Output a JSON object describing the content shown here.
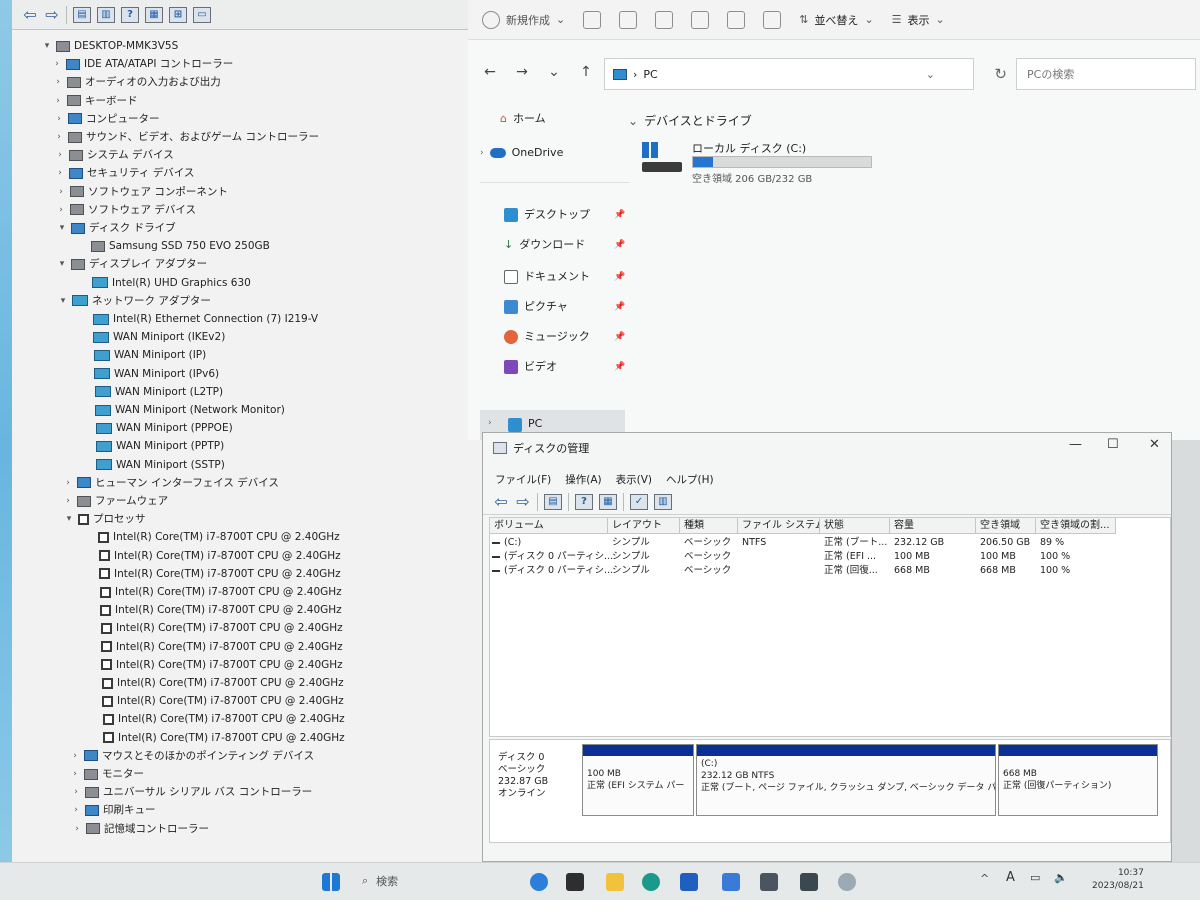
{
  "device_manager": {
    "root": "DESKTOP-MMK3V5S",
    "categories": [
      {
        "label": "IDE ATA/ATAPI コントローラー",
        "expanded": false
      },
      {
        "label": "オーディオの入力および出力",
        "expanded": false
      },
      {
        "label": "キーボード",
        "expanded": false
      },
      {
        "label": "コンピューター",
        "expanded": false
      },
      {
        "label": "サウンド、ビデオ、およびゲーム コントローラー",
        "expanded": false
      },
      {
        "label": "システム デバイス",
        "expanded": false
      },
      {
        "label": "セキュリティ デバイス",
        "expanded": false
      },
      {
        "label": "ソフトウェア コンポーネント",
        "expanded": false
      },
      {
        "label": "ソフトウェア デバイス",
        "expanded": false
      },
      {
        "label": "ディスク ドライブ",
        "expanded": true
      },
      {
        "label": "ディスプレイ アダプター",
        "expanded": true
      },
      {
        "label": "ネットワーク アダプター",
        "expanded": true
      },
      {
        "label": "ヒューマン インターフェイス デバイス",
        "expanded": false
      },
      {
        "label": "ファームウェア",
        "expanded": false
      },
      {
        "label": "プロセッサ",
        "expanded": true
      },
      {
        "label": "マウスとそのほかのポインティング デバイス",
        "expanded": false
      },
      {
        "label": "モニター",
        "expanded": false
      },
      {
        "label": "ユニバーサル シリアル バス コントローラー",
        "expanded": false
      },
      {
        "label": "印刷キュー",
        "expanded": false
      },
      {
        "label": "記憶域コントローラー",
        "expanded": false
      }
    ],
    "disk_drives": [
      "Samsung SSD 750 EVO 250GB"
    ],
    "display_adapters": [
      "Intel(R) UHD Graphics 630"
    ],
    "network_adapters": [
      "Intel(R) Ethernet Connection (7) I219-V",
      "WAN Miniport (IKEv2)",
      "WAN Miniport (IP)",
      "WAN Miniport (IPv6)",
      "WAN Miniport (L2TP)",
      "WAN Miniport (Network Monitor)",
      "WAN Miniport (PPPOE)",
      "WAN Miniport (PPTP)",
      "WAN Miniport (SSTP)"
    ],
    "processor_label": "Intel(R) Core(TM) i7-8700T CPU @ 2.40GHz",
    "processor_count": 12
  },
  "explorer": {
    "commands": [
      "新規作成",
      "並べ替え",
      "表示"
    ],
    "address": "PC",
    "search_placeholder": "PCの検索",
    "nav": {
      "home": "ホーム",
      "onedrive": "OneDrive",
      "desktop": "デスクトップ",
      "downloads": "ダウンロード",
      "documents": "ドキュメント",
      "pictures": "ピクチャ",
      "music": "ミュージック",
      "videos": "ビデオ",
      "pc": "PC"
    },
    "section_title": "デバイスとドライブ",
    "drive": {
      "name": "ローカル ディスク (C:)",
      "space_text": "空き領域 206 GB/232 GB",
      "used_fraction": 0.11
    }
  },
  "disk_mgmt": {
    "title": "ディスクの管理",
    "menu": [
      "ファイル(F)",
      "操作(A)",
      "表示(V)",
      "ヘルプ(H)"
    ],
    "columns": [
      "ボリューム",
      "レイアウト",
      "種類",
      "ファイル システム",
      "状態",
      "容量",
      "空き領域",
      "空き領域の割..."
    ],
    "rows": [
      [
        "(C:)",
        "シンプル",
        "ベーシック",
        "NTFS",
        "正常 (ブート...",
        "232.12 GB",
        "206.50 GB",
        "89 %"
      ],
      [
        "(ディスク 0 パーティシ...",
        "シンプル",
        "ベーシック",
        "",
        "正常 (EFI ...",
        "100 MB",
        "100 MB",
        "100 %"
      ],
      [
        "(ディスク 0 パーティシ...",
        "シンプル",
        "ベーシック",
        "",
        "正常 (回復...",
        "668 MB",
        "668 MB",
        "100 %"
      ]
    ],
    "disk": {
      "name": "ディスク 0",
      "type": "ベーシック",
      "size": "232.87 GB",
      "status": "オンライン"
    },
    "partitions": [
      {
        "title": "",
        "size": "100 MB",
        "status": "正常 (EFI システム パー"
      },
      {
        "title": "(C:)",
        "size": "232.12 GB NTFS",
        "status": "正常 (ブート, ページ ファイル, クラッシュ ダンプ, ベーシック データ パーティ"
      },
      {
        "title": "",
        "size": "668 MB",
        "status": "正常 (回復パーティション)"
      }
    ]
  },
  "taskbar": {
    "search": "検索",
    "time": "10:37",
    "date": "2023/08/21",
    "ime": "A"
  }
}
